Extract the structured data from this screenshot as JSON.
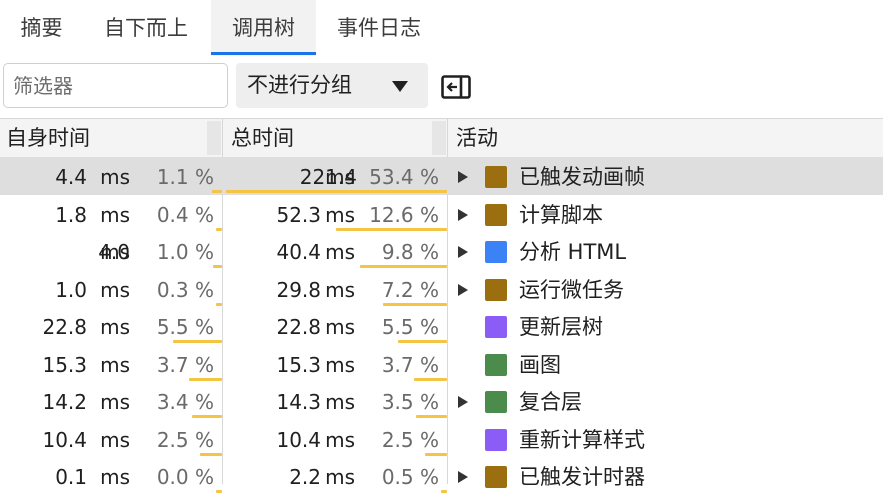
{
  "tabs": [
    {
      "label": "摘要",
      "active": false
    },
    {
      "label": "自下而上",
      "active": false
    },
    {
      "label": "调用树",
      "active": true
    },
    {
      "label": "事件日志",
      "active": false
    }
  ],
  "toolbar": {
    "filter_placeholder": "筛选器",
    "group_by_value": "不进行分组"
  },
  "columns": {
    "self_time": "自身时间",
    "total_time": "总时间",
    "activity": "活动"
  },
  "unit": "ms",
  "colors": {
    "accent": "#1a73e8",
    "bar": "#f4c542",
    "scripting": "#9b6e0f",
    "loading": "#3b82f6",
    "rendering": "#8b5cf6",
    "painting": "#4b8b4b"
  },
  "rows": [
    {
      "self_ms": "4.4",
      "self_pct": "1.1 %",
      "self_frac": 0.011,
      "total_ms": "221.4",
      "total_pct": "53.4 %",
      "total_frac": 0.534,
      "expandable": true,
      "color": "#9b6e0f",
      "activity": "已触发动画帧",
      "selected": true
    },
    {
      "self_ms": "1.8",
      "self_pct": "0.4 %",
      "self_frac": 0.004,
      "total_ms": "52.3",
      "total_pct": "12.6 %",
      "total_frac": 0.126,
      "expandable": true,
      "color": "#9b6e0f",
      "activity": "计算脚本",
      "selected": false
    },
    {
      "self_ms": "4.0",
      "self_pct": "1.0 %",
      "self_frac": 0.01,
      "total_ms": "40.4",
      "total_pct": "9.8 %",
      "total_frac": 0.098,
      "expandable": true,
      "color": "#3b82f6",
      "activity": "分析 HTML",
      "selected": false
    },
    {
      "self_ms": "1.0",
      "self_pct": "0.3 %",
      "self_frac": 0.003,
      "total_ms": "29.8",
      "total_pct": "7.2 %",
      "total_frac": 0.072,
      "expandable": true,
      "color": "#9b6e0f",
      "activity": "运行微任务",
      "selected": false
    },
    {
      "self_ms": "22.8",
      "self_pct": "5.5 %",
      "self_frac": 0.055,
      "total_ms": "22.8",
      "total_pct": "5.5 %",
      "total_frac": 0.055,
      "expandable": false,
      "color": "#8b5cf6",
      "activity": "更新层树",
      "selected": false
    },
    {
      "self_ms": "15.3",
      "self_pct": "3.7 %",
      "self_frac": 0.037,
      "total_ms": "15.3",
      "total_pct": "3.7 %",
      "total_frac": 0.037,
      "expandable": false,
      "color": "#4b8b4b",
      "activity": "画图",
      "selected": false
    },
    {
      "self_ms": "14.2",
      "self_pct": "3.4 %",
      "self_frac": 0.034,
      "total_ms": "14.3",
      "total_pct": "3.5 %",
      "total_frac": 0.035,
      "expandable": true,
      "color": "#4b8b4b",
      "activity": "复合层",
      "selected": false
    },
    {
      "self_ms": "10.4",
      "self_pct": "2.5 %",
      "self_frac": 0.025,
      "total_ms": "10.4",
      "total_pct": "2.5 %",
      "total_frac": 0.025,
      "expandable": false,
      "color": "#8b5cf6",
      "activity": "重新计算样式",
      "selected": false
    },
    {
      "self_ms": "0.1",
      "self_pct": "0.0 %",
      "self_frac": 0.0,
      "total_ms": "2.2",
      "total_pct": "0.5 %",
      "total_frac": 0.005,
      "expandable": true,
      "color": "#9b6e0f",
      "activity": "已触发计时器",
      "selected": false
    }
  ]
}
